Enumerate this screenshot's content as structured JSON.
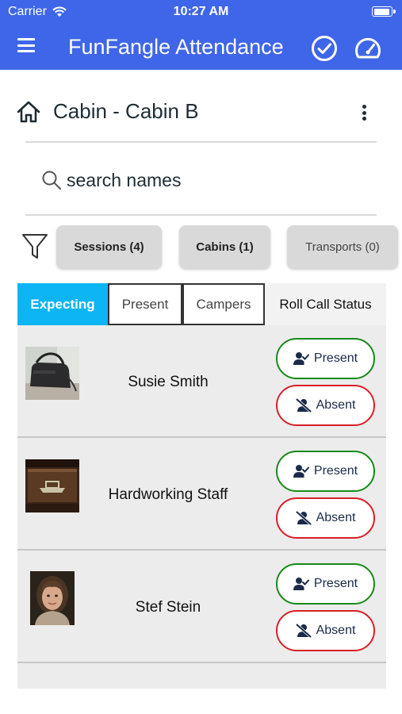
{
  "status_bar": {
    "carrier": "Carrier",
    "time": "10:27 AM"
  },
  "app": {
    "title": "FunFangle Attendance",
    "accent_color": "#3f66e8"
  },
  "page": {
    "title": "Cabin - Cabin B"
  },
  "search": {
    "placeholder": "search names"
  },
  "filters": {
    "sessions": "Sessions (4)",
    "cabins": "Cabins (1)",
    "transports": "Transports (0)"
  },
  "tabs": {
    "expecting": "Expecting",
    "present": "Present",
    "campers": "Campers",
    "roll_call_status": "Roll Call Status",
    "active_color": "#0db5f4"
  },
  "people": [
    {
      "name": "Susie Smith",
      "present_label": "Present",
      "absent_label": "Absent"
    },
    {
      "name": "Hardworking Staff",
      "present_label": "Present",
      "absent_label": "Absent"
    },
    {
      "name": "Stef Stein",
      "present_label": "Present",
      "absent_label": "Absent"
    }
  ],
  "colors": {
    "present_border": "#178a17",
    "absent_border": "#d81f26"
  },
  "icons": [
    "menu-icon",
    "check-circle-icon",
    "speedometer-icon",
    "home-icon",
    "kebab-menu-icon",
    "search-icon",
    "filter-icon",
    "user-check-icon",
    "user-slash-icon"
  ]
}
